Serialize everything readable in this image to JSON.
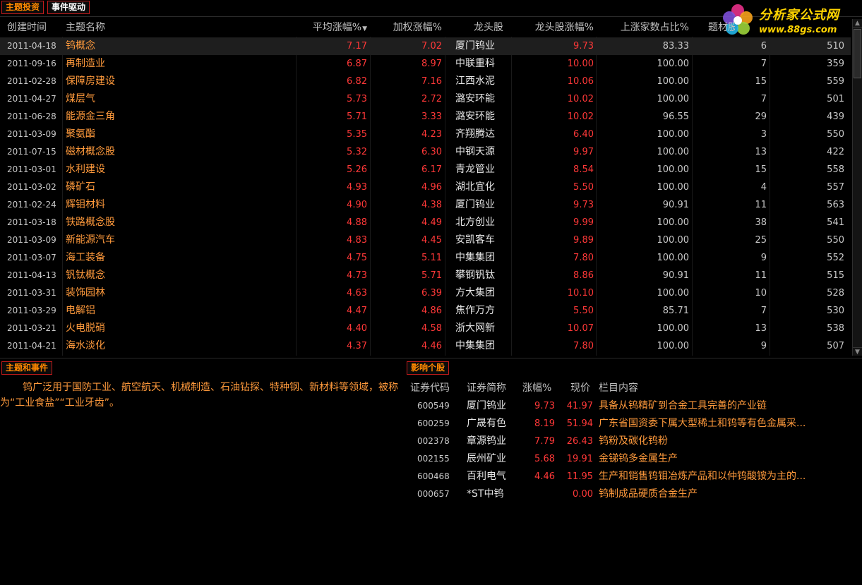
{
  "tabs": [
    "主题投资",
    "事件驱动"
  ],
  "logo": {
    "title": "分析家公式网",
    "url": "www.88gs.com"
  },
  "table": {
    "headers": [
      "创建时间",
      "主题名称",
      "平均涨幅%",
      "加权涨幅%",
      "龙头股",
      "龙头股涨幅%",
      "上涨家数占比%",
      "题材股个数"
    ],
    "rows": [
      [
        "2011-04-18",
        "钨概念",
        "7.17",
        "7.02",
        "厦门钨业",
        "9.73",
        "83.33",
        "6",
        "510"
      ],
      [
        "2011-09-16",
        "再制造业",
        "6.87",
        "8.97",
        "中联重科",
        "10.00",
        "100.00",
        "7",
        "359"
      ],
      [
        "2011-02-28",
        "保障房建设",
        "6.82",
        "7.16",
        "江西水泥",
        "10.06",
        "100.00",
        "15",
        "559"
      ],
      [
        "2011-04-27",
        "煤层气",
        "5.73",
        "2.72",
        "潞安环能",
        "10.02",
        "100.00",
        "7",
        "501"
      ],
      [
        "2011-06-28",
        "能源金三角",
        "5.71",
        "3.33",
        "潞安环能",
        "10.02",
        "96.55",
        "29",
        "439"
      ],
      [
        "2011-03-09",
        "聚氨酯",
        "5.35",
        "4.23",
        "齐翔腾达",
        "6.40",
        "100.00",
        "3",
        "550"
      ],
      [
        "2011-07-15",
        "磁材概念股",
        "5.32",
        "6.30",
        "中钢天源",
        "9.97",
        "100.00",
        "13",
        "422"
      ],
      [
        "2011-03-01",
        "水利建设",
        "5.26",
        "6.17",
        "青龙管业",
        "8.54",
        "100.00",
        "15",
        "558"
      ],
      [
        "2011-03-02",
        "磷矿石",
        "4.93",
        "4.96",
        "湖北宜化",
        "5.50",
        "100.00",
        "4",
        "557"
      ],
      [
        "2011-02-24",
        "辉钼材料",
        "4.90",
        "4.38",
        "厦门钨业",
        "9.73",
        "90.91",
        "11",
        "563"
      ],
      [
        "2011-03-18",
        "铁路概念股",
        "4.88",
        "4.49",
        "北方创业",
        "9.99",
        "100.00",
        "38",
        "541"
      ],
      [
        "2011-03-09",
        "新能源汽车",
        "4.83",
        "4.45",
        "安凯客车",
        "9.89",
        "100.00",
        "25",
        "550"
      ],
      [
        "2011-03-07",
        "海工装备",
        "4.75",
        "5.11",
        "中集集团",
        "7.80",
        "100.00",
        "9",
        "552"
      ],
      [
        "2011-04-13",
        "钒钛概念",
        "4.73",
        "5.71",
        "攀钢钒钛",
        "8.86",
        "90.91",
        "11",
        "515"
      ],
      [
        "2011-03-31",
        "装饰园林",
        "4.63",
        "6.39",
        "方大集团",
        "10.10",
        "100.00",
        "10",
        "528"
      ],
      [
        "2011-03-29",
        "电解铝",
        "4.47",
        "4.86",
        "焦作万方",
        "5.50",
        "85.71",
        "7",
        "530"
      ],
      [
        "2011-03-21",
        "火电脱硝",
        "4.40",
        "4.58",
        "浙大网新",
        "10.07",
        "100.00",
        "13",
        "538"
      ],
      [
        "2011-04-21",
        "海水淡化",
        "4.37",
        "4.46",
        "中集集团",
        "7.80",
        "100.00",
        "9",
        "507"
      ]
    ]
  },
  "bottom_left": {
    "tab": "主题和事件",
    "text": "钨广泛用于国防工业、航空航天、机械制造、石油钻探、特种钢、新材料等领域，被称为“工业食盐”“工业牙齿”。"
  },
  "bottom_right": {
    "tab": "影响个股",
    "headers": [
      "证券代码",
      "证券简称",
      "涨幅%",
      "现价",
      "栏目内容"
    ],
    "rows": [
      [
        "600549",
        "厦门钨业",
        "9.73",
        "41.97",
        "具备从钨精矿到合金工具完善的产业链"
      ],
      [
        "600259",
        "广晟有色",
        "8.19",
        "51.94",
        "广东省国资委下属大型稀土和钨等有色金属采..."
      ],
      [
        "002378",
        "章源钨业",
        "7.79",
        "26.43",
        "钨粉及碳化钨粉"
      ],
      [
        "002155",
        "辰州矿业",
        "5.68",
        "19.91",
        "金锑钨多金属生产"
      ],
      [
        "600468",
        "百利电气",
        "4.46",
        "11.95",
        "生产和销售钨钼冶炼产品和以仲钨酸铵为主的..."
      ],
      [
        "000657",
        "*ST中钨",
        "",
        "0.00",
        "钨制成品硬质合金生产"
      ]
    ]
  }
}
